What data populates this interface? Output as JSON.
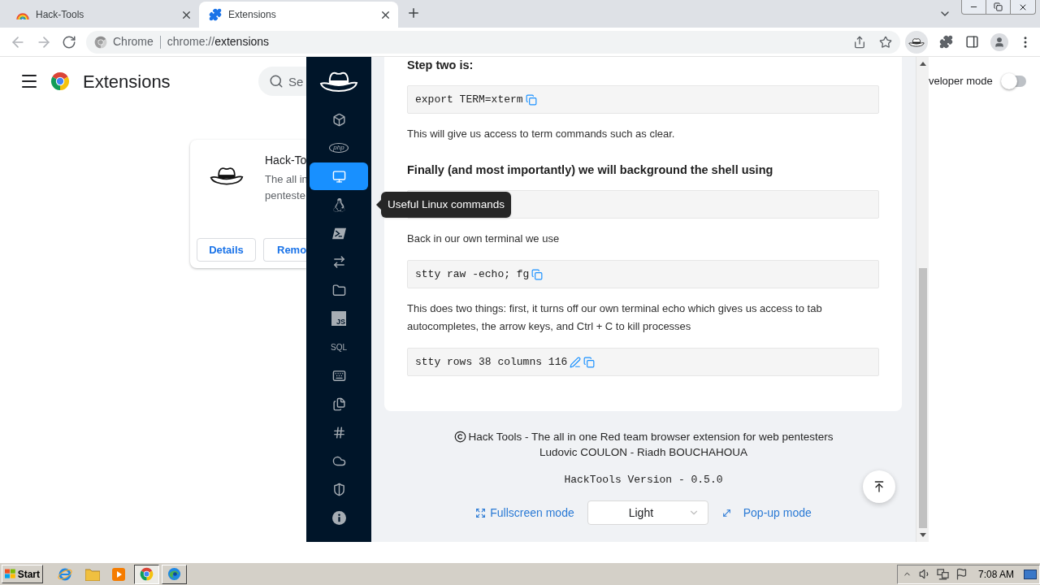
{
  "browser": {
    "tabs": [
      {
        "title": "Hack-Tools",
        "selected": false
      },
      {
        "title": "Extensions",
        "selected": true
      }
    ],
    "omnibox": {
      "site_label": "Chrome",
      "url_scheme": "chrome://",
      "url_path": "extensions"
    }
  },
  "extensions_page": {
    "title": "Extensions",
    "search": {
      "placeholder": "Se"
    },
    "developer_mode": {
      "label": "veloper mode",
      "on": false
    },
    "extension_card": {
      "name": "Hack-To",
      "description_lines": [
        "The all in",
        "penteste"
      ],
      "buttons": [
        "Details",
        "Remo"
      ]
    }
  },
  "popup": {
    "sidebar": {
      "items": [
        {
          "kind": "icon",
          "selected": false
        },
        {
          "kind": "oval",
          "label": "php",
          "selected": false
        },
        {
          "kind": "icon",
          "selected": true
        },
        {
          "kind": "icon",
          "selected": false,
          "tooltip": "Useful Linux commands"
        },
        {
          "kind": "icon",
          "selected": false
        },
        {
          "kind": "icon",
          "selected": false
        },
        {
          "kind": "icon",
          "selected": false
        },
        {
          "kind": "tile",
          "label": "JS",
          "selected": false
        },
        {
          "kind": "text",
          "label": "SQL",
          "selected": false
        },
        {
          "kind": "icon",
          "selected": false
        },
        {
          "kind": "icon",
          "selected": false
        },
        {
          "kind": "icon",
          "selected": false
        },
        {
          "kind": "icon",
          "selected": false
        },
        {
          "kind": "icon",
          "selected": false
        },
        {
          "kind": "icon",
          "selected": false
        }
      ]
    },
    "content": [
      {
        "kind": "heading",
        "text": "Step two is:"
      },
      {
        "kind": "code",
        "code": "export TERM=xterm",
        "copy": true
      },
      {
        "kind": "text",
        "text": "This will give us access to term commands such as clear."
      },
      {
        "kind": "heading",
        "text": "Finally (and most importantly) we will background the shell using"
      },
      {
        "kind": "code"
      },
      {
        "kind": "text",
        "text": "Back in our own terminal we use"
      },
      {
        "kind": "code",
        "code": "stty raw -echo; fg",
        "copy": true
      },
      {
        "kind": "text",
        "text": "This does two things: first, it turns off our own terminal echo which gives us access to tab autocompletes, the arrow keys, and Ctrl + C to kill processes"
      },
      {
        "kind": "code",
        "code": "stty rows 38 columns 116",
        "edit": true,
        "copy": true
      }
    ],
    "footer": {
      "credits": "Hack Tools - The all in one Red team browser extension for web pentesters",
      "authors": "Ludovic COULON - Riadh BOUCHAHOUA",
      "version": "HackTools Version - 0.5.0",
      "fullscreen_link": "Fullscreen mode",
      "theme_select": {
        "value": "Light"
      },
      "popup_link": "Pop-up mode"
    }
  },
  "taskbar": {
    "start_label": "Start",
    "windows": [
      {
        "selected": true
      },
      {
        "selected": false
      }
    ],
    "clock": "7:08 AM"
  }
}
